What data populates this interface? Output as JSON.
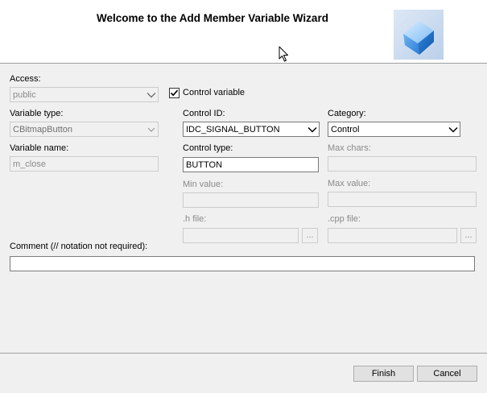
{
  "header": {
    "title": "Welcome to the Add Member Variable Wizard",
    "logo_icon": "cube-icon"
  },
  "access": {
    "label": "Access:",
    "value": "public"
  },
  "control_variable": {
    "label": "Control variable",
    "checked": true
  },
  "variable_type": {
    "label": "Variable type:",
    "value": "CBitmapButton"
  },
  "control_id": {
    "label": "Control ID:",
    "value": "IDC_SIGNAL_BUTTON"
  },
  "category": {
    "label": "Category:",
    "value": "Control"
  },
  "variable_name": {
    "label": "Variable name:",
    "value": "m_close"
  },
  "control_type": {
    "label": "Control type:",
    "value": "BUTTON"
  },
  "max_chars": {
    "label": "Max chars:",
    "value": ""
  },
  "min_value": {
    "label": "Min value:",
    "value": ""
  },
  "max_value": {
    "label": "Max value:",
    "value": ""
  },
  "h_file": {
    "label": ".h file:",
    "value": "",
    "browse_label": "..."
  },
  "cpp_file": {
    "label": ".cpp file:",
    "value": "",
    "browse_label": "..."
  },
  "comment": {
    "label": "Comment (// notation not required):",
    "value": ""
  },
  "footer": {
    "finish_label": "Finish",
    "cancel_label": "Cancel"
  },
  "colors": {
    "background": "#f0f0f0",
    "header_background": "#ffffff",
    "disabled_text": "#8a8a8a",
    "logo_blue": "#3f8fe0"
  }
}
